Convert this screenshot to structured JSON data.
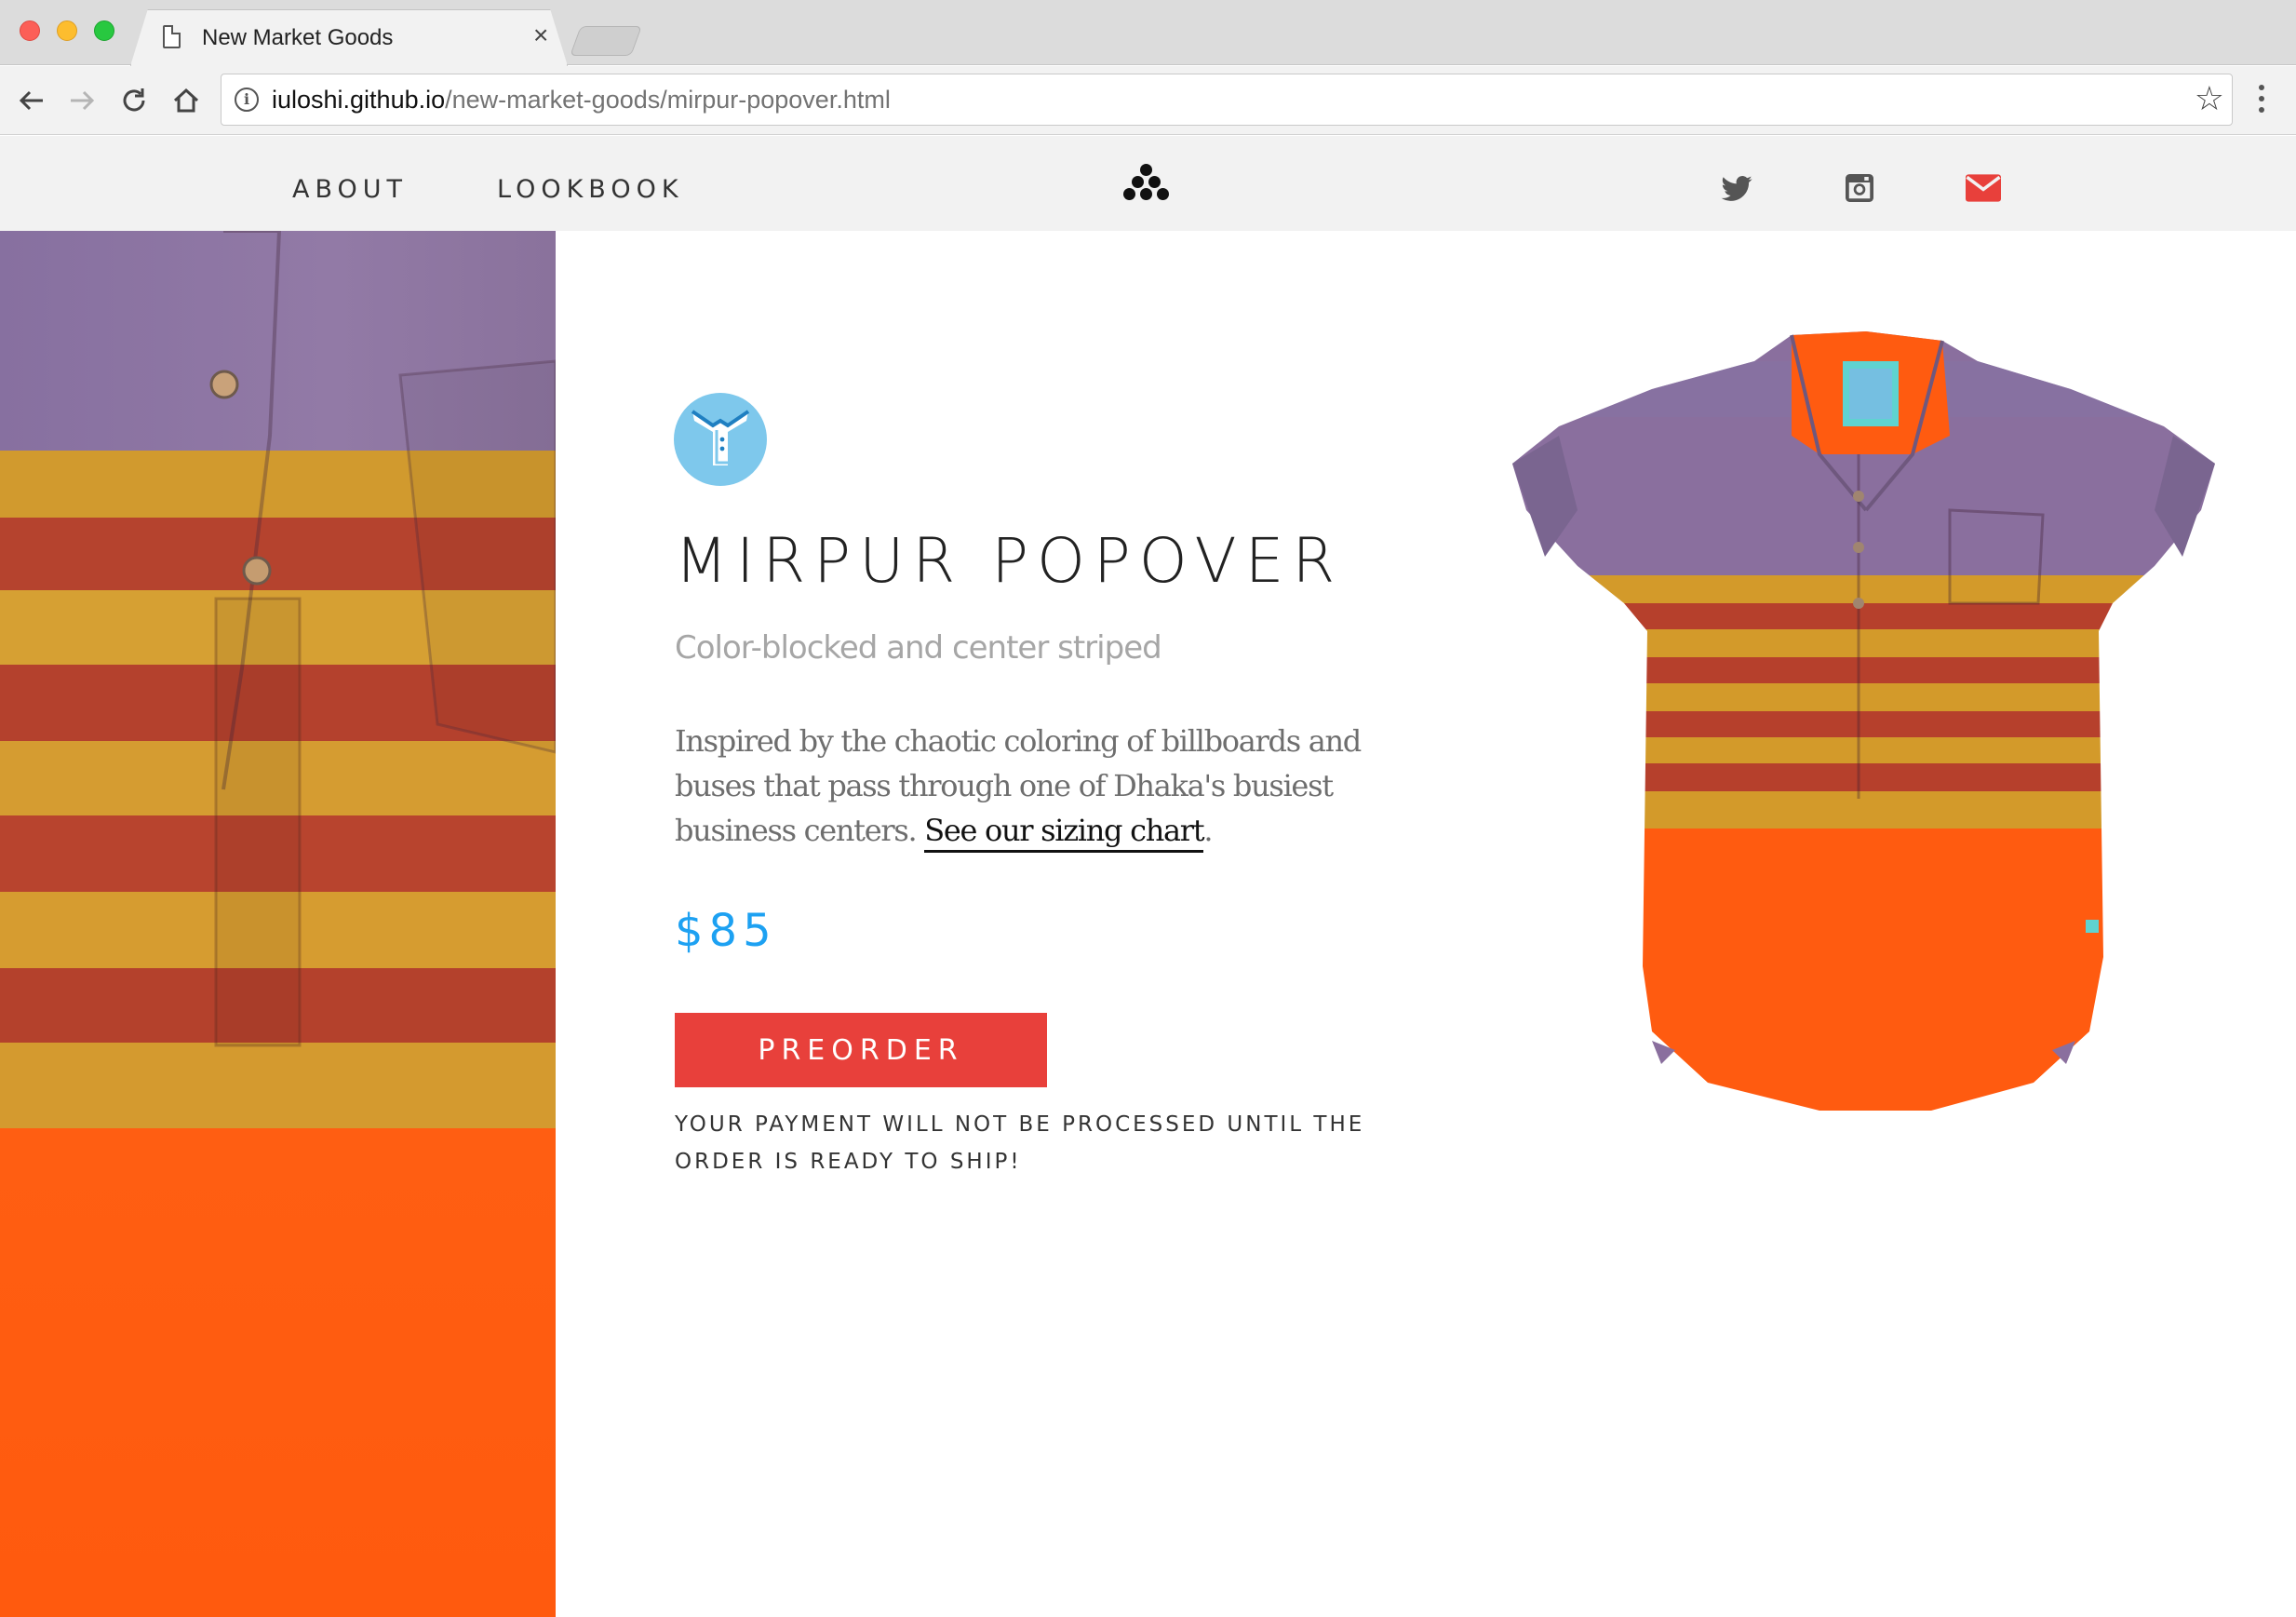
{
  "browser": {
    "tab_title": "New Market Goods",
    "tab_close": "×",
    "url_host": "iuloshi.github.io",
    "url_path": "/new-market-goods/mirpur-popover.html",
    "star": "☆"
  },
  "nav": {
    "about": "ABOUT",
    "lookbook": "LOOKBOOK",
    "icons": [
      "twitter-icon",
      "instagram-icon",
      "mail-icon"
    ]
  },
  "product": {
    "title": "MIRPUR POPOVER",
    "subtitle": "Color-blocked and center striped",
    "description": "Inspired by the chaotic coloring of billboards and buses that pass through one of Dhaka's busiest business centers. ",
    "sizing_link": "See our sizing chart",
    "description_end": ".",
    "price": "$85",
    "button": "PREORDER",
    "note": "YOUR PAYMENT WILL NOT BE PROCESSED UNTIL THE ORDER IS READY TO SHIP!"
  },
  "colors": {
    "accent_blue": "#1da1f2",
    "button_red": "#e8403b",
    "mail_red": "#e8403b",
    "badge_blue": "#7ec8ec",
    "shirt_purple": "#8a6f9e",
    "shirt_gold": "#d39a2a",
    "shirt_rust": "#b6402c",
    "shirt_orange": "#ff5b10"
  }
}
